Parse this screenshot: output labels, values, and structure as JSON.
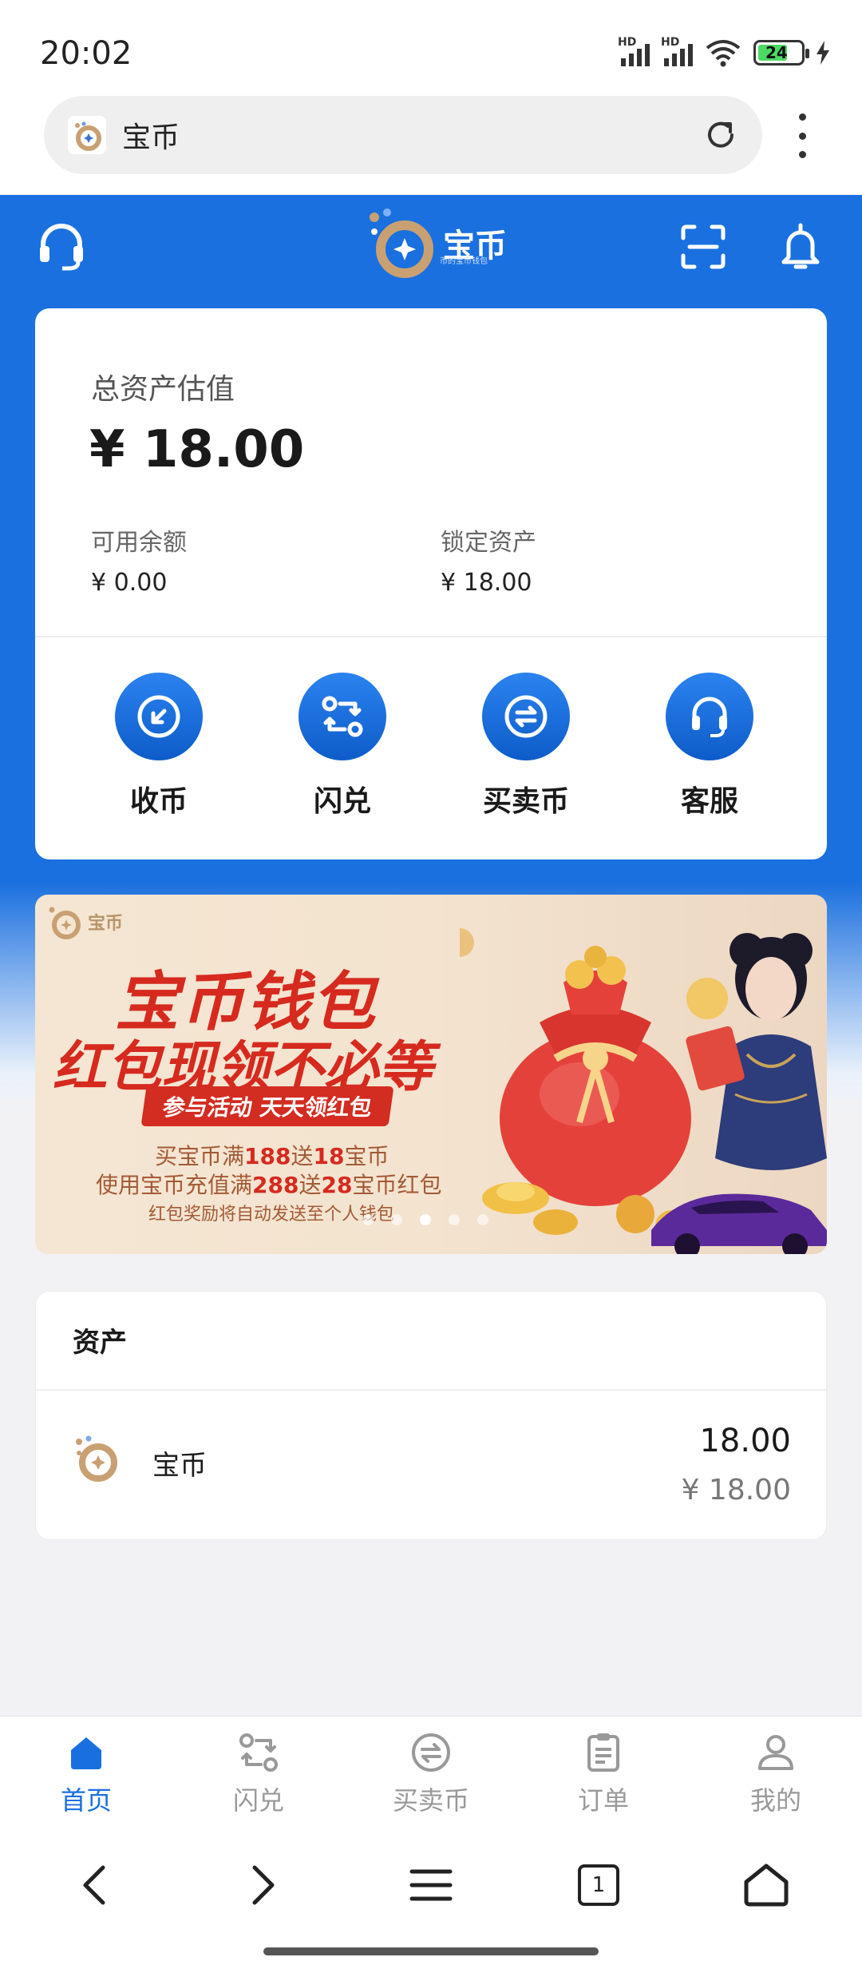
{
  "status_bar": {
    "time": "20:02",
    "signal_label_1": "HD",
    "signal_label_2": "HD",
    "battery": "24"
  },
  "browser": {
    "url_title": "宝币",
    "reload_icon": "reload-icon",
    "menu_icon": "more-vertical-icon"
  },
  "header": {
    "logo_text": "宝币",
    "logo_subtitle": "币的宝币钱包"
  },
  "asset_card": {
    "title": "总资产估值",
    "total": "¥ 18.00",
    "available_label": "可用余额",
    "available_value": "¥ 0.00",
    "locked_label": "锁定资产",
    "locked_value": "¥ 18.00",
    "actions": [
      {
        "label": "收币",
        "icon": "receive-icon"
      },
      {
        "label": "闪兑",
        "icon": "swap-icon"
      },
      {
        "label": "买卖币",
        "icon": "exchange-icon"
      },
      {
        "label": "客服",
        "icon": "headset-icon"
      }
    ]
  },
  "banner": {
    "logo_text": "宝币",
    "headline_1": "宝币钱包",
    "headline_2": "红包现领不必等",
    "pill": "参与活动  天天领红包",
    "line_1_a": "买宝币满",
    "line_1_b": "188",
    "line_1_c": "送",
    "line_1_d": "18",
    "line_1_e": "宝币",
    "line_2_a": "使用宝币充值满",
    "line_2_b": "288",
    "line_2_c": "送",
    "line_2_d": "28",
    "line_2_e": "宝币红包",
    "line_3": "红包奖励将自动发送至个人钱包",
    "carousel_total": 5,
    "carousel_active": 3
  },
  "assets": {
    "heading": "资产",
    "items": [
      {
        "name": "宝币",
        "amount": "18.00",
        "cny": "¥ 18.00"
      }
    ]
  },
  "tabbar": {
    "tabs": [
      {
        "label": "首页",
        "icon": "home-icon",
        "active": true
      },
      {
        "label": "闪兑",
        "icon": "swap-icon",
        "active": false
      },
      {
        "label": "买卖币",
        "icon": "exchange-icon",
        "active": false
      },
      {
        "label": "订单",
        "icon": "clipboard-icon",
        "active": false
      },
      {
        "label": "我的",
        "icon": "user-icon",
        "active": false
      }
    ]
  },
  "navbar": {
    "tabs_count": "1"
  },
  "colors": {
    "primary": "#1a70df",
    "banner_red": "#d62a1f",
    "logo_gold": "#c9a072"
  }
}
